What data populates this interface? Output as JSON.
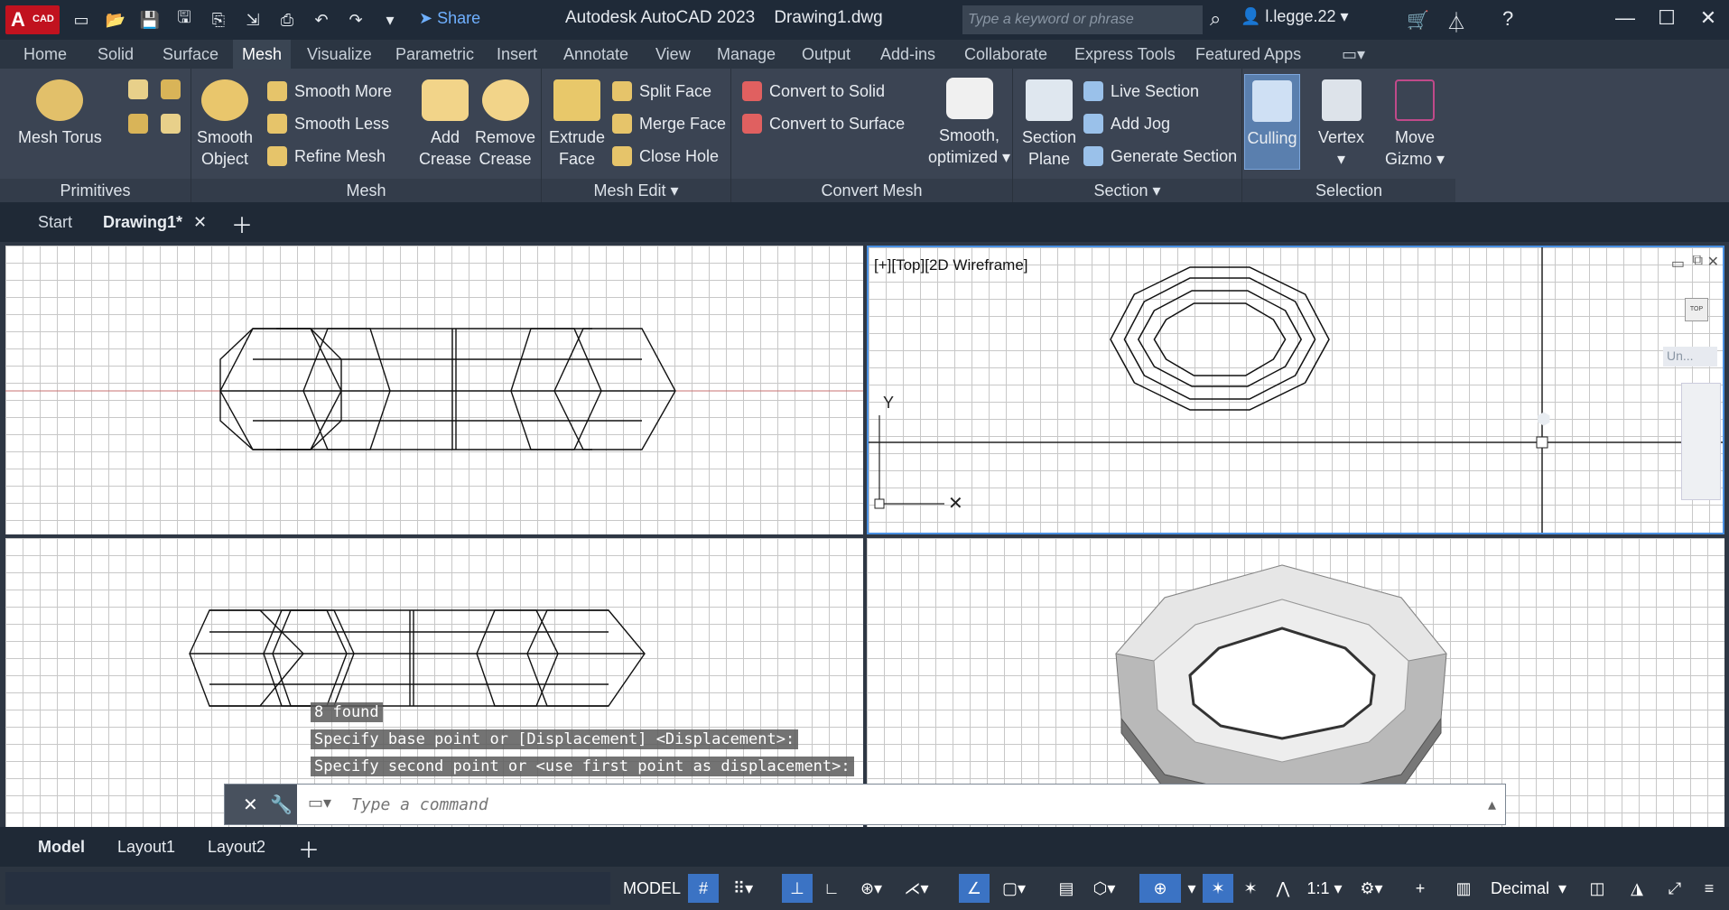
{
  "title_bar": {
    "logo_text": "A",
    "logo_sub": "CAD",
    "share": "Share",
    "app_title": "Autodesk AutoCAD 2023",
    "file_title": "Drawing1.dwg",
    "search_placeholder": "Type a keyword or phrase",
    "user": "l.legge.22"
  },
  "ribbon_tabs": [
    "Home",
    "Solid",
    "Surface",
    "Mesh",
    "Visualize",
    "Parametric",
    "Insert",
    "Annotate",
    "View",
    "Manage",
    "Output",
    "Add-ins",
    "Collaborate",
    "Express Tools",
    "Featured Apps"
  ],
  "active_tab": "Mesh",
  "panels": {
    "primitives": {
      "label": "Primitives",
      "mesh_torus": "Mesh Torus"
    },
    "mesh": {
      "label": "Mesh",
      "smooth_object_1": "Smooth",
      "smooth_object_2": "Object",
      "smooth_more": "Smooth More",
      "smooth_less": "Smooth Less",
      "refine_mesh": "Refine Mesh",
      "add_crease_1": "Add",
      "add_crease_2": "Crease",
      "remove_crease_1": "Remove",
      "remove_crease_2": "Crease"
    },
    "mesh_edit": {
      "label": "Mesh Edit",
      "extrude_face_1": "Extrude",
      "extrude_face_2": "Face",
      "split_face": "Split Face",
      "merge_face": "Merge Face",
      "close_hole": "Close Hole"
    },
    "convert_mesh": {
      "label": "Convert Mesh",
      "convert_solid": "Convert to Solid",
      "convert_surface": "Convert to Surface",
      "smooth_opt_1": "Smooth,",
      "smooth_opt_2": "optimized"
    },
    "section": {
      "label": "Section",
      "section_plane_1": "Section",
      "section_plane_2": "Plane",
      "live_section": "Live Section",
      "add_jog": "Add Jog",
      "generate_section": "Generate Section"
    },
    "selection": {
      "label": "Selection",
      "culling": "Culling",
      "vertex": "Vertex",
      "move_gizmo_1": "Move",
      "move_gizmo_2": "Gizmo"
    }
  },
  "doc_tabs": {
    "start": "Start",
    "drawing": "Drawing1*"
  },
  "viewport_label": "[+][Top][2D Wireframe]",
  "viewcube_top": "TOP",
  "viewcube_wcs": "Un...",
  "command_history": [
    "8 found",
    "Specify base point or [Displacement] <Displacement>:",
    "Specify second point or <use first point as displacement>:"
  ],
  "command_placeholder": "Type a command",
  "layout_tabs": [
    "Model",
    "Layout1",
    "Layout2"
  ],
  "status": {
    "model": "MODEL",
    "scale": "1:1",
    "units": "Decimal"
  },
  "colors": {
    "accent": "#3b73c4",
    "titlebar": "#1f2a38",
    "ribbon": "#3b4453",
    "viewport_border_active": "#4a90e2"
  }
}
